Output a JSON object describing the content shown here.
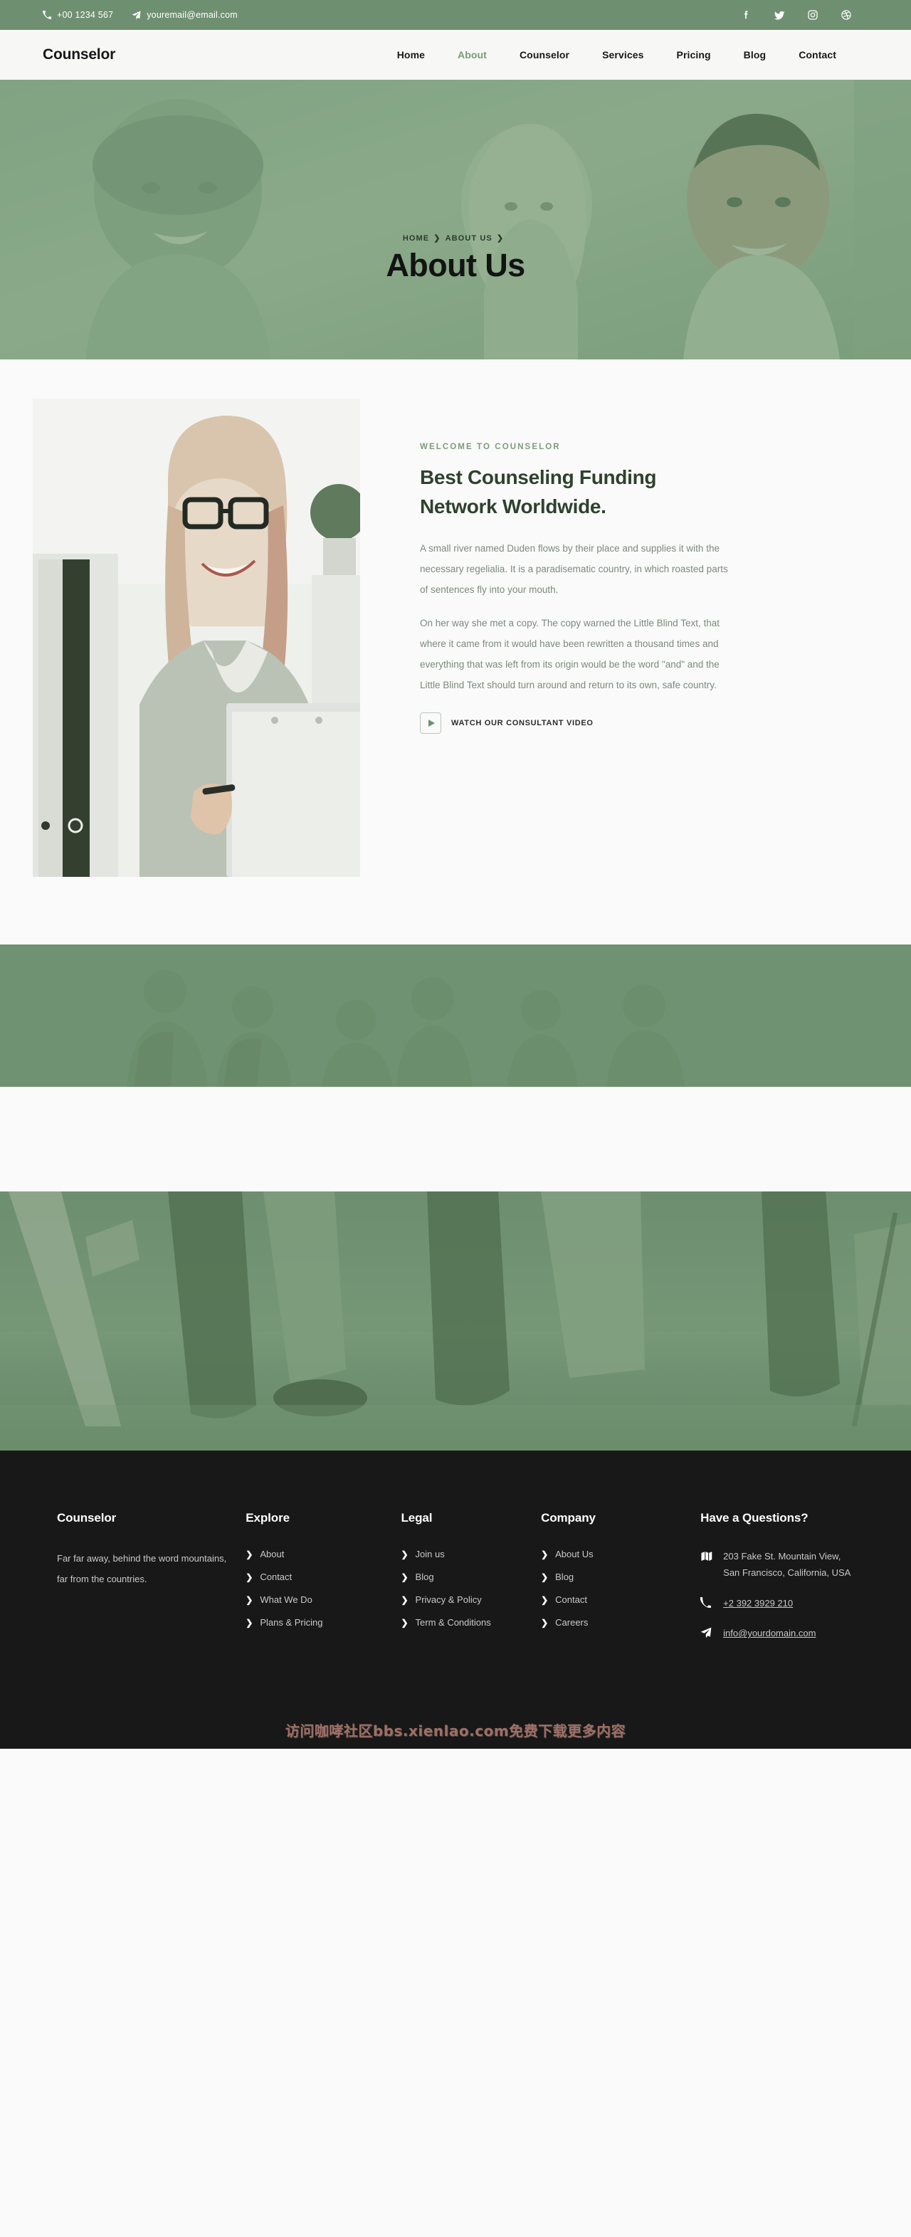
{
  "topbar": {
    "phone": "+00 1234 567",
    "email": "youremail@email.com",
    "socials": [
      {
        "name": "facebook",
        "label": "f"
      },
      {
        "name": "twitter",
        "label": "t"
      },
      {
        "name": "instagram",
        "label": "i"
      },
      {
        "name": "dribbble",
        "label": "d"
      }
    ]
  },
  "nav": {
    "brand": "Counselor",
    "items": [
      {
        "label": "Home",
        "active": false
      },
      {
        "label": "About",
        "active": true
      },
      {
        "label": "Counselor",
        "active": false
      },
      {
        "label": "Services",
        "active": false
      },
      {
        "label": "Pricing",
        "active": false
      },
      {
        "label": "Blog",
        "active": false
      },
      {
        "label": "Contact",
        "active": false
      }
    ]
  },
  "hero": {
    "breadcrumb": [
      {
        "label": "HOME"
      },
      {
        "label": "ABOUT US"
      }
    ],
    "separator": "❯",
    "title": "About Us"
  },
  "about": {
    "eyebrow": "WELCOME TO COUNSELOR",
    "heading": "Best Counseling Funding Network Worldwide.",
    "paragraph1": "A small river named Duden flows by their place and supplies it with the necessary regelialia. It is a paradisematic country, in which roasted parts of sentences fly into your mouth.",
    "paragraph2": "On her way she met a copy. The copy warned the Little Blind Text, that where it came from it would have been rewritten a thousand times and everything that was left from its origin would be the word \"and\" and the Little Blind Text should turn around and return to its own, safe country.",
    "video_label": "WATCH OUR CONSULTANT VIDEO"
  },
  "footer": {
    "brand": {
      "title": "Counselor",
      "description": "Far far away, behind the word mountains, far from the countries."
    },
    "columns": [
      {
        "title": "Explore",
        "links": [
          "About",
          "Contact",
          "What We Do",
          "Plans & Pricing"
        ]
      },
      {
        "title": "Legal",
        "links": [
          "Join us",
          "Blog",
          "Privacy & Policy",
          "Term & Conditions"
        ]
      },
      {
        "title": "Company",
        "links": [
          "About Us",
          "Blog",
          "Contact",
          "Careers"
        ]
      }
    ],
    "contact": {
      "title": "Have a Questions?",
      "address": "203 Fake St. Mountain View, San Francisco, California, USA",
      "phone": "+2 392 3929 210",
      "email": "info@yourdomain.com"
    }
  },
  "watermark": "访问咖哮社区bbs.xienlao.com免费下载更多内容",
  "colors": {
    "brand_green": "#6f8f71",
    "accent_green": "#7a9a7c",
    "dark_green": "#2f412f",
    "footer_bg": "#181818",
    "page_bg": "#fafafa"
  }
}
